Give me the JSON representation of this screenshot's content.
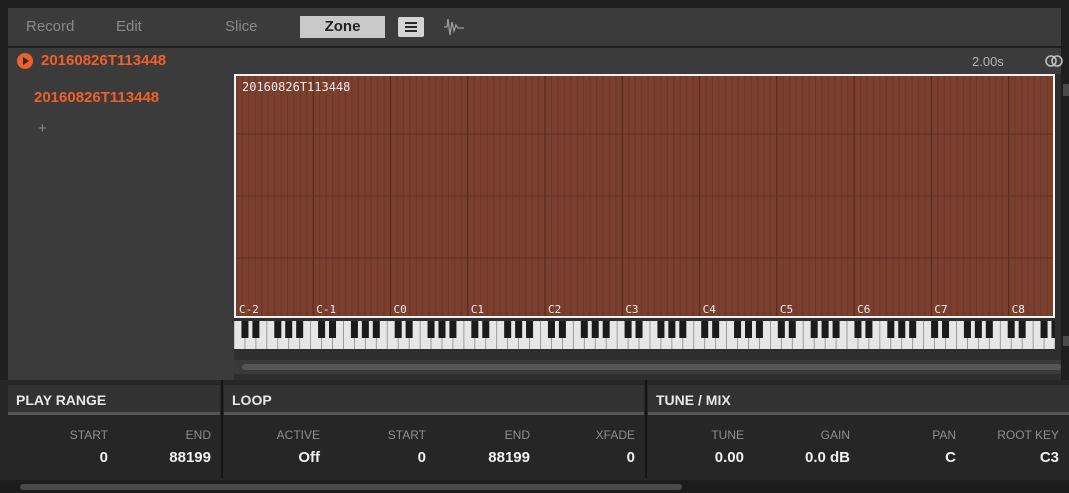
{
  "tabs": {
    "record": "Record",
    "edit": "Edit",
    "slice": "Slice",
    "zone": "Zone"
  },
  "sample": {
    "title": "20160826T113448",
    "duration": "2.00s"
  },
  "zone_list": {
    "items": [
      "20160826T113448"
    ],
    "add_label": "+"
  },
  "zone_map": {
    "zone_label": "20160826T113448",
    "zone_color": "#7b3f2e",
    "note_labels": [
      "C-2",
      "C-1",
      "C0",
      "C1",
      "C2",
      "C3",
      "C4",
      "C5",
      "C6",
      "C7",
      "C8"
    ]
  },
  "params": {
    "play_range": {
      "title": "PLAY RANGE",
      "start_label": "START",
      "start_value": "0",
      "end_label": "END",
      "end_value": "88199"
    },
    "loop": {
      "title": "LOOP",
      "active_label": "ACTIVE",
      "active_value": "Off",
      "start_label": "START",
      "start_value": "0",
      "end_label": "END",
      "end_value": "88199",
      "xfade_label": "XFADE",
      "xfade_value": "0"
    },
    "tune_mix": {
      "title": "TUNE / MIX",
      "tune_label": "TUNE",
      "tune_value": "0.00",
      "gain_label": "GAIN",
      "gain_value": "0.0 dB",
      "pan_label": "PAN",
      "pan_value": "C",
      "rootkey_label": "ROOT KEY",
      "rootkey_value": "C3"
    }
  },
  "colors": {
    "accent": "#f0602a",
    "zone": "#7b3f2e"
  }
}
